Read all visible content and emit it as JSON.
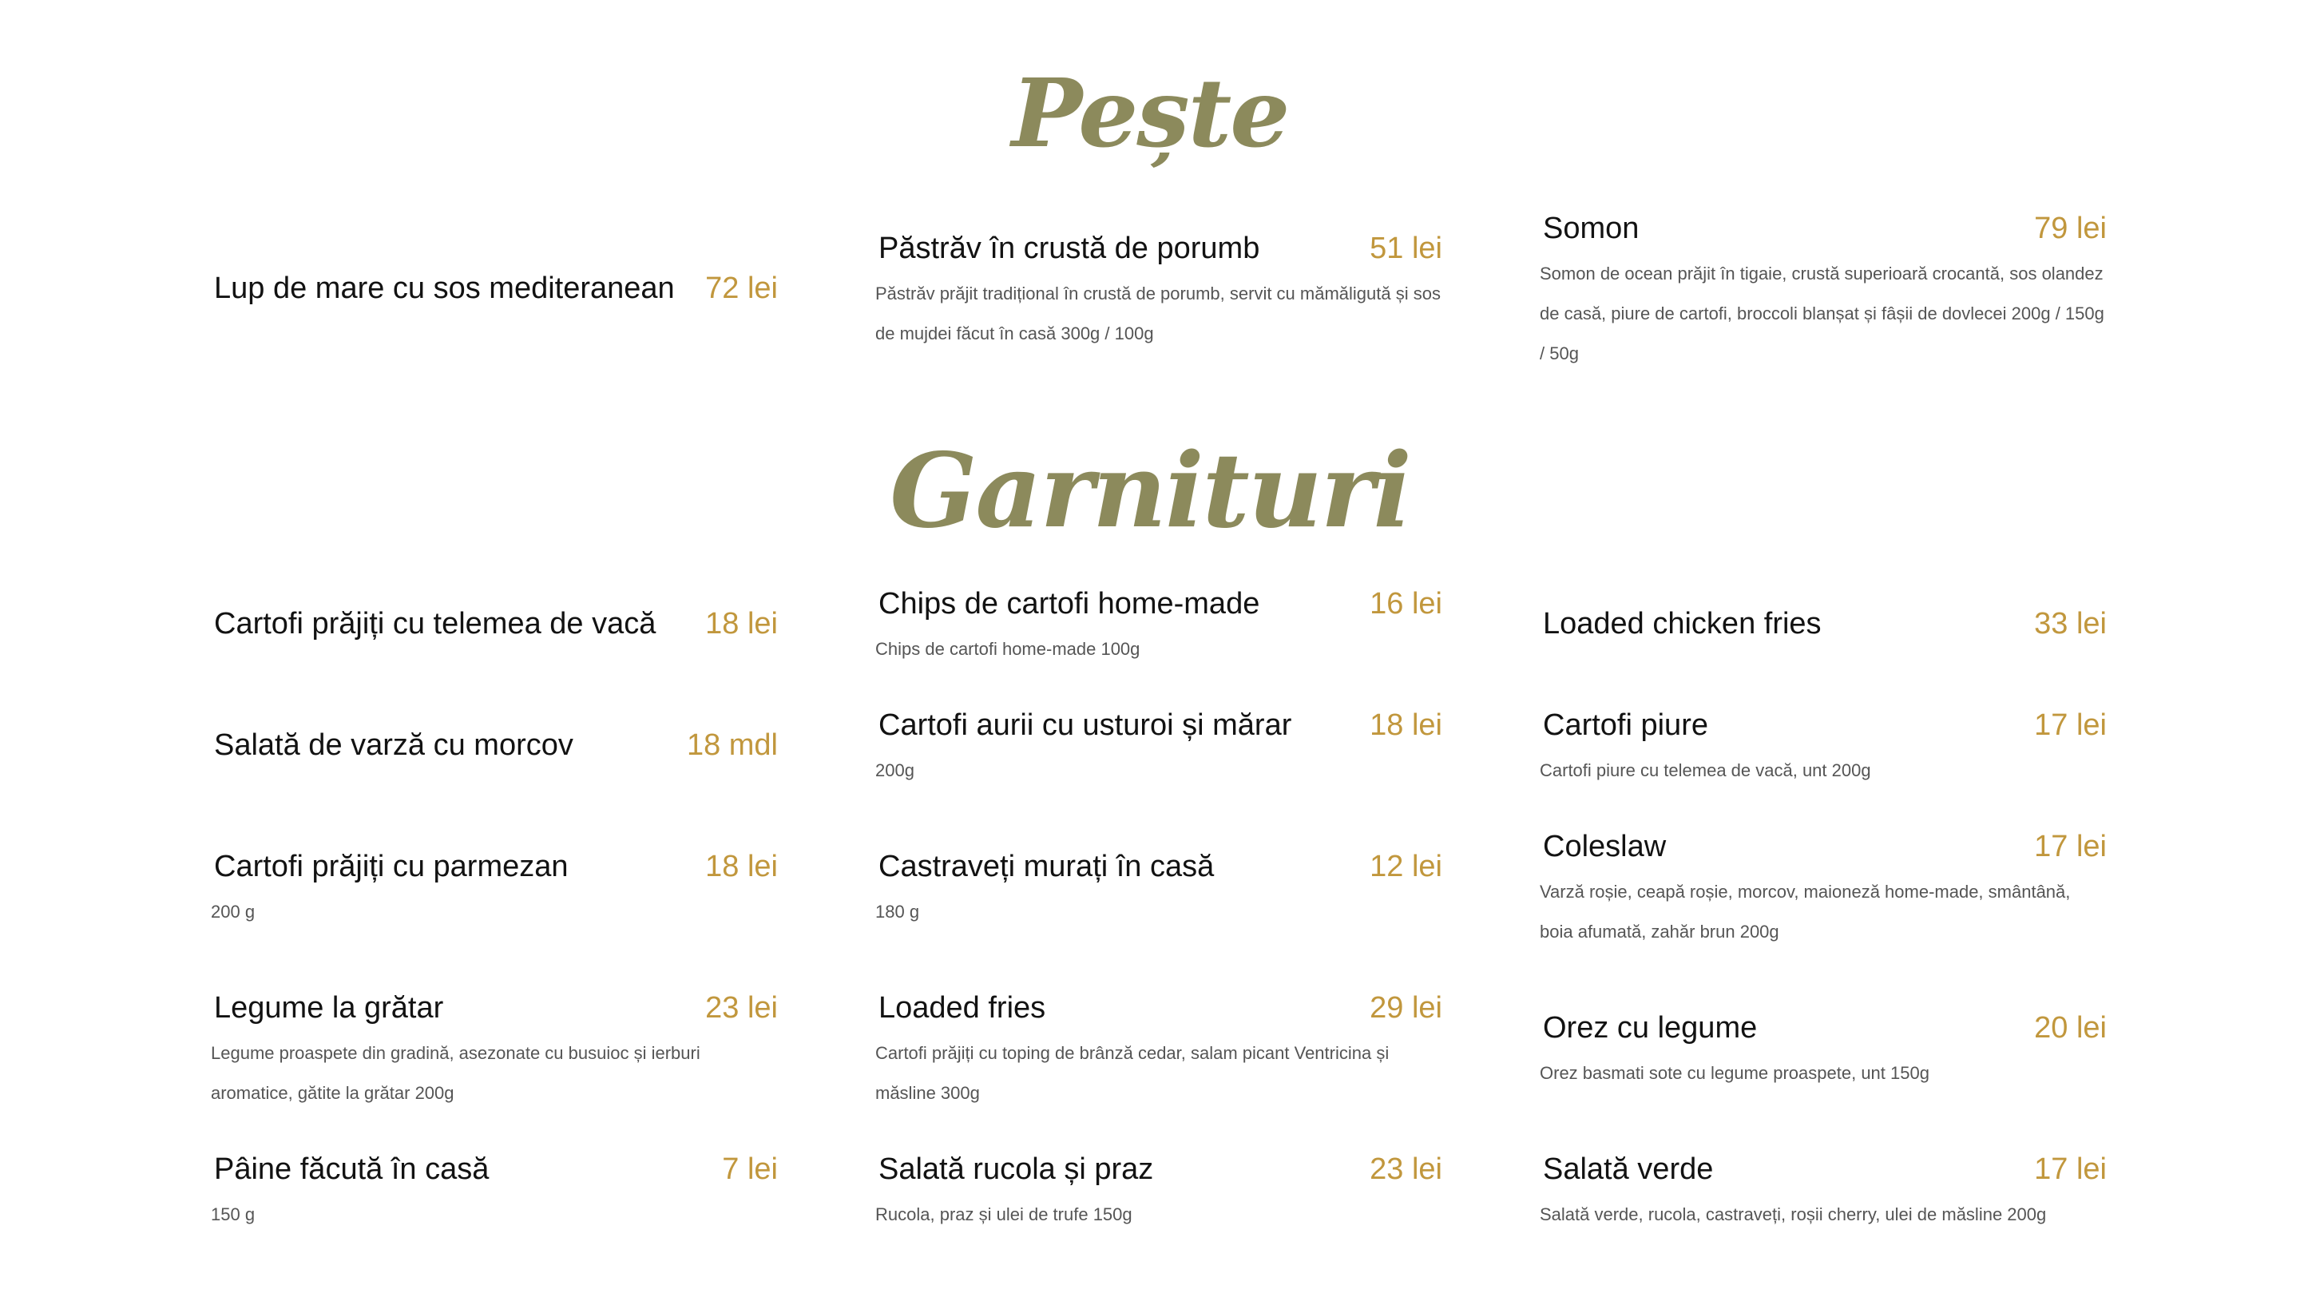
{
  "sections": {
    "peste": {
      "title": "Pește",
      "items": [
        {
          "name": "Lup de mare cu sos mediteranean",
          "price": "72 lei",
          "desc": ""
        },
        {
          "name": "Păstrăv în crustă de porumb",
          "price": "51 lei",
          "desc": "Păstrăv prăjit tradițional în crustă de porumb, servit cu mămăligută și sos de mujdei făcut în casă 300g / 100g"
        },
        {
          "name": "Somon",
          "price": "79 lei",
          "desc": "Somon de ocean prăjit în tigaie, crustă superioară crocantă, sos olandez de casă, piure de cartofi, broccoli blanșat și fâșii de dovlecei 200g / 150g / 50g"
        }
      ]
    },
    "garnituri": {
      "title": "Garnituri",
      "items": [
        {
          "name": "Cartofi prăjiți cu telemea de vacă",
          "price": "18 lei",
          "desc": ""
        },
        {
          "name": "Chips de cartofi home-made",
          "price": "16 lei",
          "desc": "Chips de cartofi home-made 100g"
        },
        {
          "name": "Loaded chicken fries",
          "price": "33 lei",
          "desc": ""
        },
        {
          "name": "Salată de varză cu morcov",
          "price": "18 mdl",
          "desc": ""
        },
        {
          "name": "Cartofi aurii cu usturoi și mărar",
          "price": "18 lei",
          "desc": "200g"
        },
        {
          "name": "Cartofi piure",
          "price": "17 lei",
          "desc": "Cartofi piure cu telemea de vacă, unt 200g"
        },
        {
          "name": "Cartofi prăjiți cu parmezan",
          "price": "18 lei",
          "desc": "200 g"
        },
        {
          "name": "Castraveți murați în casă",
          "price": "12 lei",
          "desc": "180 g"
        },
        {
          "name": "Coleslaw",
          "price": "17 lei",
          "desc": "Varză roșie, ceapă roșie, morcov, maioneză home-made, smântână, boia afumată, zahăr brun 200g"
        },
        {
          "name": "Legume la grătar",
          "price": "23 lei",
          "desc": "Legume proaspete din gradină, asezonate cu busuioc și ierburi aromatice, gătite la grătar 200g"
        },
        {
          "name": "Loaded fries",
          "price": "29 lei",
          "desc": "Cartofi prăjiți cu toping de brânză cedar, salam picant Ventricina și măsline 300g"
        },
        {
          "name": "Orez cu legume",
          "price": "20 lei",
          "desc": "Orez basmati sote cu legume proaspete, unt 150g"
        },
        {
          "name": "Pâine făcută în casă",
          "price": "7 lei",
          "desc": "150 g"
        },
        {
          "name": "Salată rucola și praz",
          "price": "23 lei",
          "desc": "Rucola, praz și ulei de trufe 150g"
        },
        {
          "name": "Salată verde",
          "price": "17 lei",
          "desc": "Salată verde, rucola, castraveți, roșii cherry, ulei de măsline 200g"
        }
      ]
    }
  },
  "colors": {
    "title": "#8c8a5c",
    "price": "#c1973d",
    "text": "#121212",
    "description": "#555555"
  }
}
